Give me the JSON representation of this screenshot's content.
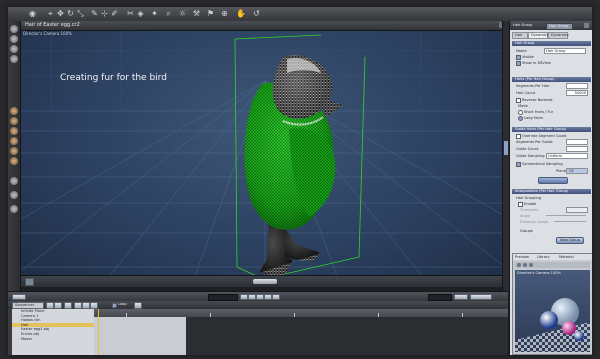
{
  "viewport": {
    "title": "Hair of Easter egg.cr2",
    "camera_label": "Director's Camera 100%",
    "overlay_text": "Creating fur for the bird"
  },
  "right_panel": {
    "header_title": "Hair Group",
    "header_select": "Hair Group",
    "tabs": [
      "Hair",
      "Dynamics",
      "Dynamics"
    ],
    "hair_group_section": "Hair Group",
    "name_label": "Name",
    "name_value": "Hair Group",
    "visible_label": "Visible",
    "show_in_3dview_label": "Show in 3DView",
    "hairs_section": "Hairs (Per Hair Group)",
    "segments_per_hair_label": "Segments Per Hair",
    "hair_count_label": "Hair Count",
    "hair_count_value": "50000",
    "reverse_normals_label": "Reverse Normals",
    "mode_label": "Mode",
    "short_hairs_label": "Short Hairs / Fur",
    "long_hairs_label": "Long Hairs",
    "guide_hairs_section": "Guide Hairs (Per Hair Group)",
    "override_segment_count_label": "Override Segment Count",
    "segments_per_guide_label": "Segments Per Guide",
    "guide_count_label": "Guide Count",
    "guide_sampling_label": "Guide Sampling",
    "guide_sampling_value": "Uniform",
    "symmetrical_sampling_label": "Symmetrical Sampling",
    "plane_label": "Plane",
    "plane_value": "YZ",
    "interpolation_section": "Interpolation (Per Hair Group)",
    "hair_grouping_label": "Hair Grouping",
    "enable_label": "Enable",
    "threshold_label": "Threshold",
    "angle_label": "Angle",
    "distance_usage_label": "Distance Usage",
    "groups_label": "Groups",
    "new_group_button": "New Group",
    "preview_tabs": [
      "Preview",
      "Library",
      "Material"
    ],
    "preview_camera": "Director's Camera 100%"
  },
  "timeline": {
    "rows": [
      "Infinite Plane",
      "Camera 1",
      "Hollow ckh",
      "Hair",
      "Easter egg1.obj",
      "Enviro obj",
      "Mover"
    ],
    "selected_row": 3,
    "toolbar_label": "Sequencer",
    "loop_label": "Loop"
  }
}
